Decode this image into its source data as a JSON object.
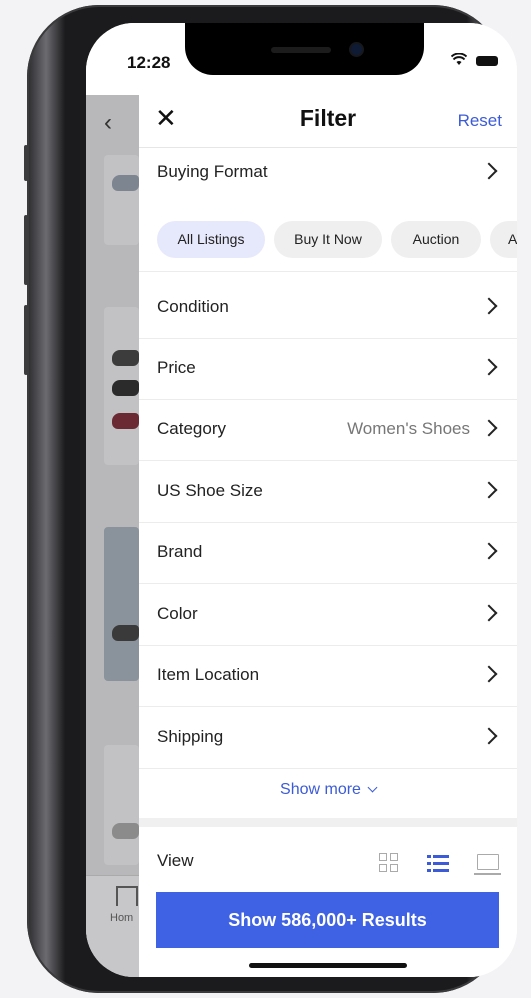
{
  "status": {
    "time": "12:28"
  },
  "header": {
    "close_label": "✕",
    "title": "Filter",
    "reset_label": "Reset"
  },
  "buying_format": {
    "label": "Buying Format",
    "options": [
      "All Listings",
      "Buy It Now",
      "Auction",
      "A"
    ],
    "selected": "All Listings"
  },
  "rows": [
    {
      "label": "Condition",
      "value": ""
    },
    {
      "label": "Price",
      "value": ""
    },
    {
      "label": "Category",
      "value": "Women's Shoes"
    },
    {
      "label": "US Shoe Size",
      "value": ""
    },
    {
      "label": "Brand",
      "value": ""
    },
    {
      "label": "Color",
      "value": ""
    },
    {
      "label": "Item Location",
      "value": ""
    },
    {
      "label": "Shipping",
      "value": ""
    }
  ],
  "show_more": "Show more",
  "view": {
    "label": "View",
    "selected": "list"
  },
  "results_button": "Show 586,000+ Results",
  "background": {
    "back_glyph": "‹",
    "tab_home_label": "Hom"
  },
  "colors": {
    "accent": "#3c5bd6",
    "button": "#3f62e4",
    "chip_selected": "#e6e8fb"
  },
  "icons": [
    "close-icon",
    "chevron-right-icon",
    "chevron-down-icon",
    "grid-view-icon",
    "list-view-icon",
    "gallery-view-icon",
    "wifi-icon",
    "battery-icon",
    "home-icon"
  ]
}
